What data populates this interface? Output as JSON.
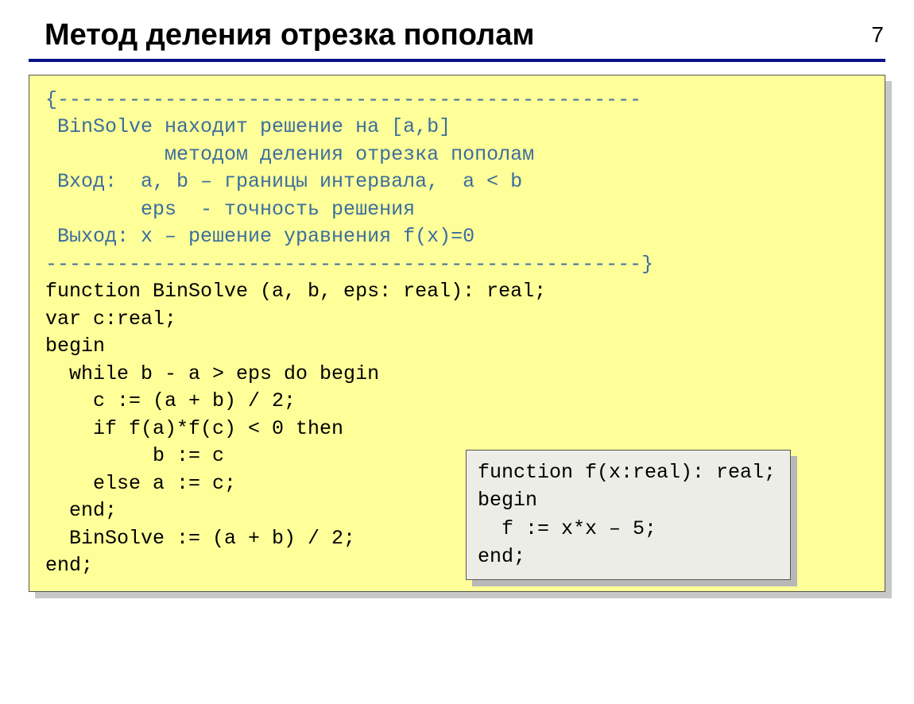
{
  "page_number": "7",
  "title": "Метод деления отрезка пополам",
  "code": {
    "comment_open": "{-------------------------------------------------",
    "c1": " BinSolve находит решение на [a,b]",
    "c2": "          методом деления отрезка пополам",
    "c3": " Вход:  a, b – границы интервала,  a < b",
    "c4": "        eps  - точность решения",
    "c5": " Выход: x – решение уравнения f(x)=0",
    "comment_close": "--------------------------------------------------}",
    "l1": "function BinSolve (a, b, eps: real): real;",
    "l2": "var c:real;",
    "l3": "begin",
    "l4": "  while b - a > eps do begin",
    "l5": "    c := (a + b) / 2;",
    "l6": "    if f(a)*f(c) < 0 then",
    "l7": "         b := c",
    "l8": "    else a := c;",
    "l9": "  end;",
    "l10": "  BinSolve := (a + b) / 2;",
    "l11": "end;"
  },
  "inset": {
    "l1": "function f(x:real): real;",
    "l2": "begin",
    "l3": "  f := x*x – 5;",
    "l4": "end;"
  }
}
